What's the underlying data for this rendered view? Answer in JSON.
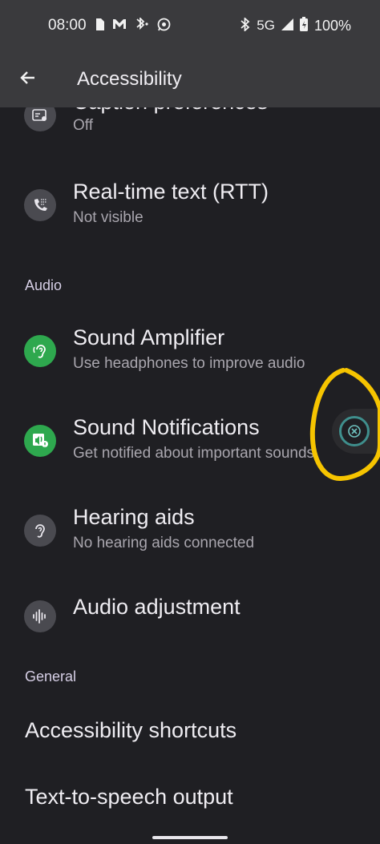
{
  "status_bar": {
    "time": "08:00",
    "network": "5G",
    "battery": "100%",
    "icons_left": [
      "sim-card-icon",
      "gmail-icon",
      "bluetooth-audio-icon",
      "whatsapp-icon"
    ],
    "icons_right": [
      "bluetooth-icon",
      "signal-icon",
      "battery-icon"
    ]
  },
  "app_bar": {
    "title": "Accessibility",
    "back_icon": "arrow-left-icon"
  },
  "items": [
    {
      "title": "Caption preferences",
      "summary": "Off",
      "icon": "captions-icon"
    },
    {
      "title": "Real-time text (RTT)",
      "summary": "Not visible",
      "icon": "rtt-phone-icon"
    },
    {
      "title": "Sound Amplifier",
      "summary": "Use headphones to improve audio",
      "icon": "ear-icon"
    },
    {
      "title": "Sound Notifications",
      "summary": "Get notified about important sounds",
      "icon": "sound-notification-icon"
    },
    {
      "title": "Hearing aids",
      "summary": "No hearing aids connected",
      "icon": "hearing-aid-icon"
    },
    {
      "title": "Audio adjustment",
      "icon": "waveform-icon"
    }
  ],
  "sections": {
    "audio": "Audio",
    "general": "General"
  },
  "general_items": [
    {
      "title": "Accessibility shortcuts"
    },
    {
      "title": "Text-to-speech output"
    }
  ],
  "floating_button": {
    "icon": "close-circle-icon"
  },
  "colors": {
    "background": "#1f1f23",
    "app_bar": "#3a3a3d",
    "accent_green": "#2ea84e",
    "annotation_yellow": "#f6c400",
    "float_teal": "#3f8f8d"
  }
}
